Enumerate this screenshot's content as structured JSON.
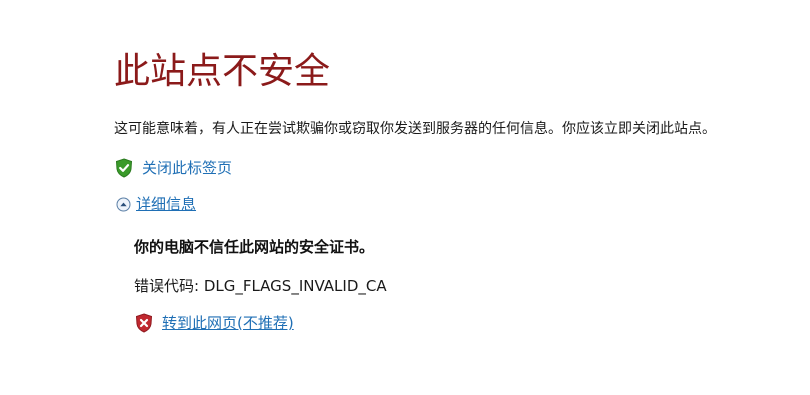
{
  "page": {
    "title": "此站点不安全",
    "warning_text": "这可能意味着，有人正在尝试欺骗你或窃取你发送到服务器的任何信息。你应该立即关闭此站点。",
    "close_tab_label": "关闭此标签页",
    "details_label": "详细信息",
    "details": {
      "cert_message": "你的电脑不信任此网站的安全证书。",
      "error_code_label": "错误代码: DLG_FLAGS_INVALID_CA",
      "continue_label": "转到此网页(不推荐)"
    }
  },
  "icons": {
    "close_tab": "shield-check-icon",
    "details_toggle": "collapse-arrow-icon",
    "continue": "shield-x-icon"
  },
  "colors": {
    "title": "#8b1a1a",
    "link": "#1f6fb5",
    "shield_ok": "#3a9a2a",
    "shield_bad": "#c0282f"
  }
}
